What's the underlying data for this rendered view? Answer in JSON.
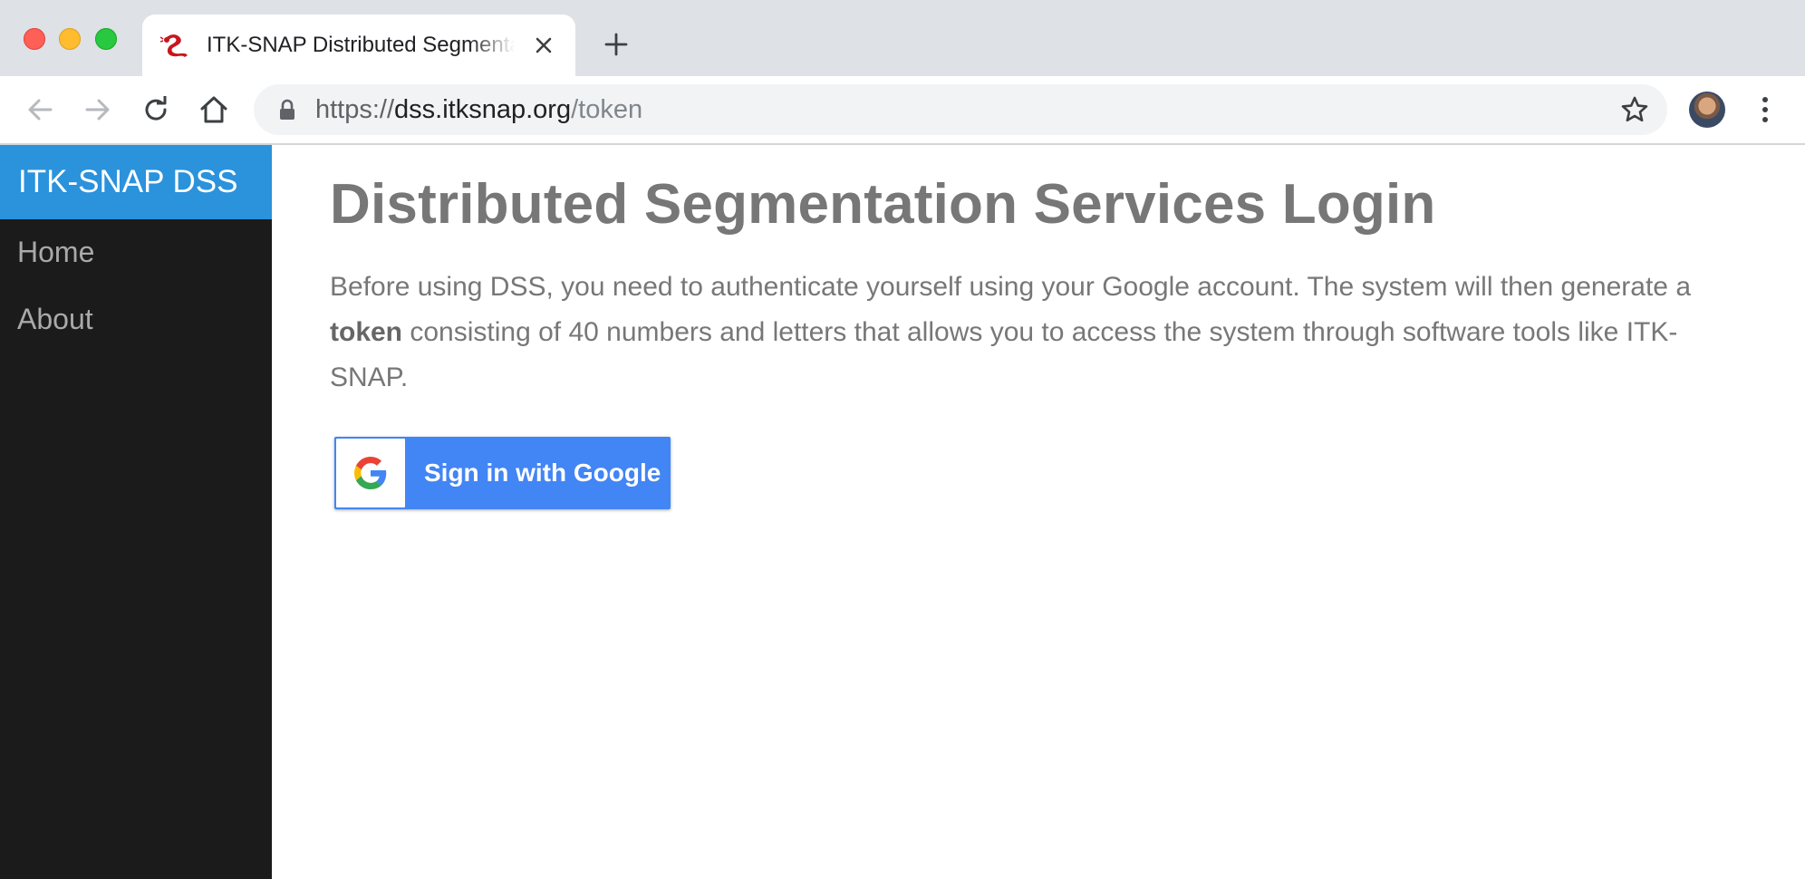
{
  "browser": {
    "tab": {
      "title": "ITK-SNAP Distributed Segmentation Services",
      "favicon": "itksnap-snake-icon"
    },
    "url": {
      "scheme": "https://",
      "host": "dss.itksnap.org",
      "path": "/token"
    },
    "icons": [
      "back-icon",
      "forward-icon",
      "reload-icon",
      "home-icon",
      "lock-icon",
      "bookmark-star-icon",
      "profile-avatar",
      "menu-dots-icon",
      "close-icon",
      "new-tab-icon"
    ]
  },
  "sidebar": {
    "brand": "ITK-SNAP DSS",
    "brand_color": "#2b92dc",
    "items": [
      {
        "label": "Home"
      },
      {
        "label": "About"
      }
    ]
  },
  "main": {
    "title": "Distributed Segmentation Services Login",
    "intro_before": "Before using DSS, you need to authenticate yourself using your Google account. The system will then generate a ",
    "intro_bold": "token",
    "intro_after": " consisting of 40 numbers and letters that allows you to access the system through software tools like ITK-SNAP.",
    "signin_label": "Sign in with Google",
    "signin_color": "#4285f4"
  }
}
